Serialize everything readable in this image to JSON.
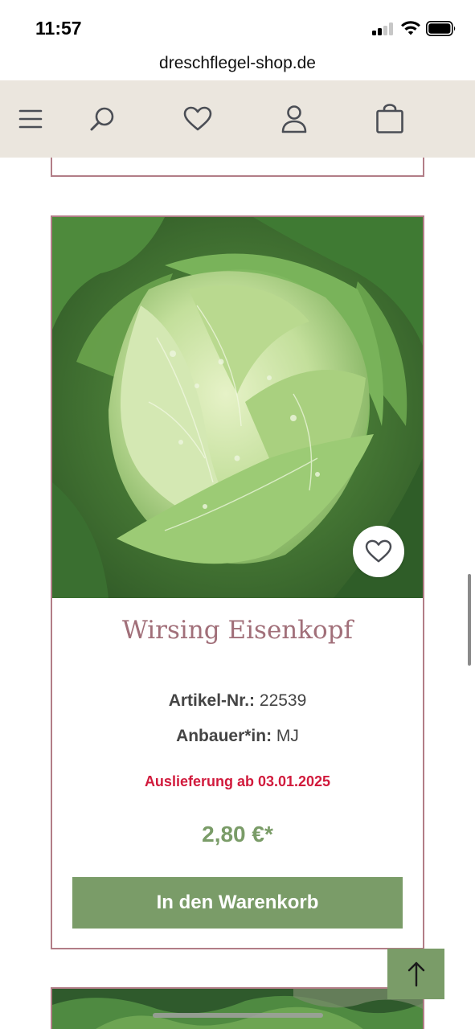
{
  "status_bar": {
    "time": "11:57",
    "icons": [
      "cellular-signal-icon",
      "wifi-icon",
      "battery-icon"
    ]
  },
  "browser": {
    "url": "dreschflegel-shop.de"
  },
  "header": {
    "icons": [
      "menu-icon",
      "search-icon",
      "heart-icon",
      "user-icon",
      "shopping-bag-icon"
    ]
  },
  "product": {
    "title": "Wirsing Eisenkopf",
    "article_label": "Artikel-Nr.:",
    "article_number": "22539",
    "grower_label": "Anbauer*in:",
    "grower_value": "MJ",
    "delivery_note": "Auslieferung ab 03.01.2025",
    "price": "2,80 €*",
    "cart_button_label": "In den Warenkorb",
    "wishlist_icon": "heart-outline-icon"
  },
  "scroll_top_icon": "arrow-up-icon",
  "colors": {
    "header_bg": "#ebe6de",
    "card_border": "#b27d87",
    "title": "#a16f79",
    "accent_green": "#7a9c68",
    "delivery_red": "#d11a3c"
  }
}
